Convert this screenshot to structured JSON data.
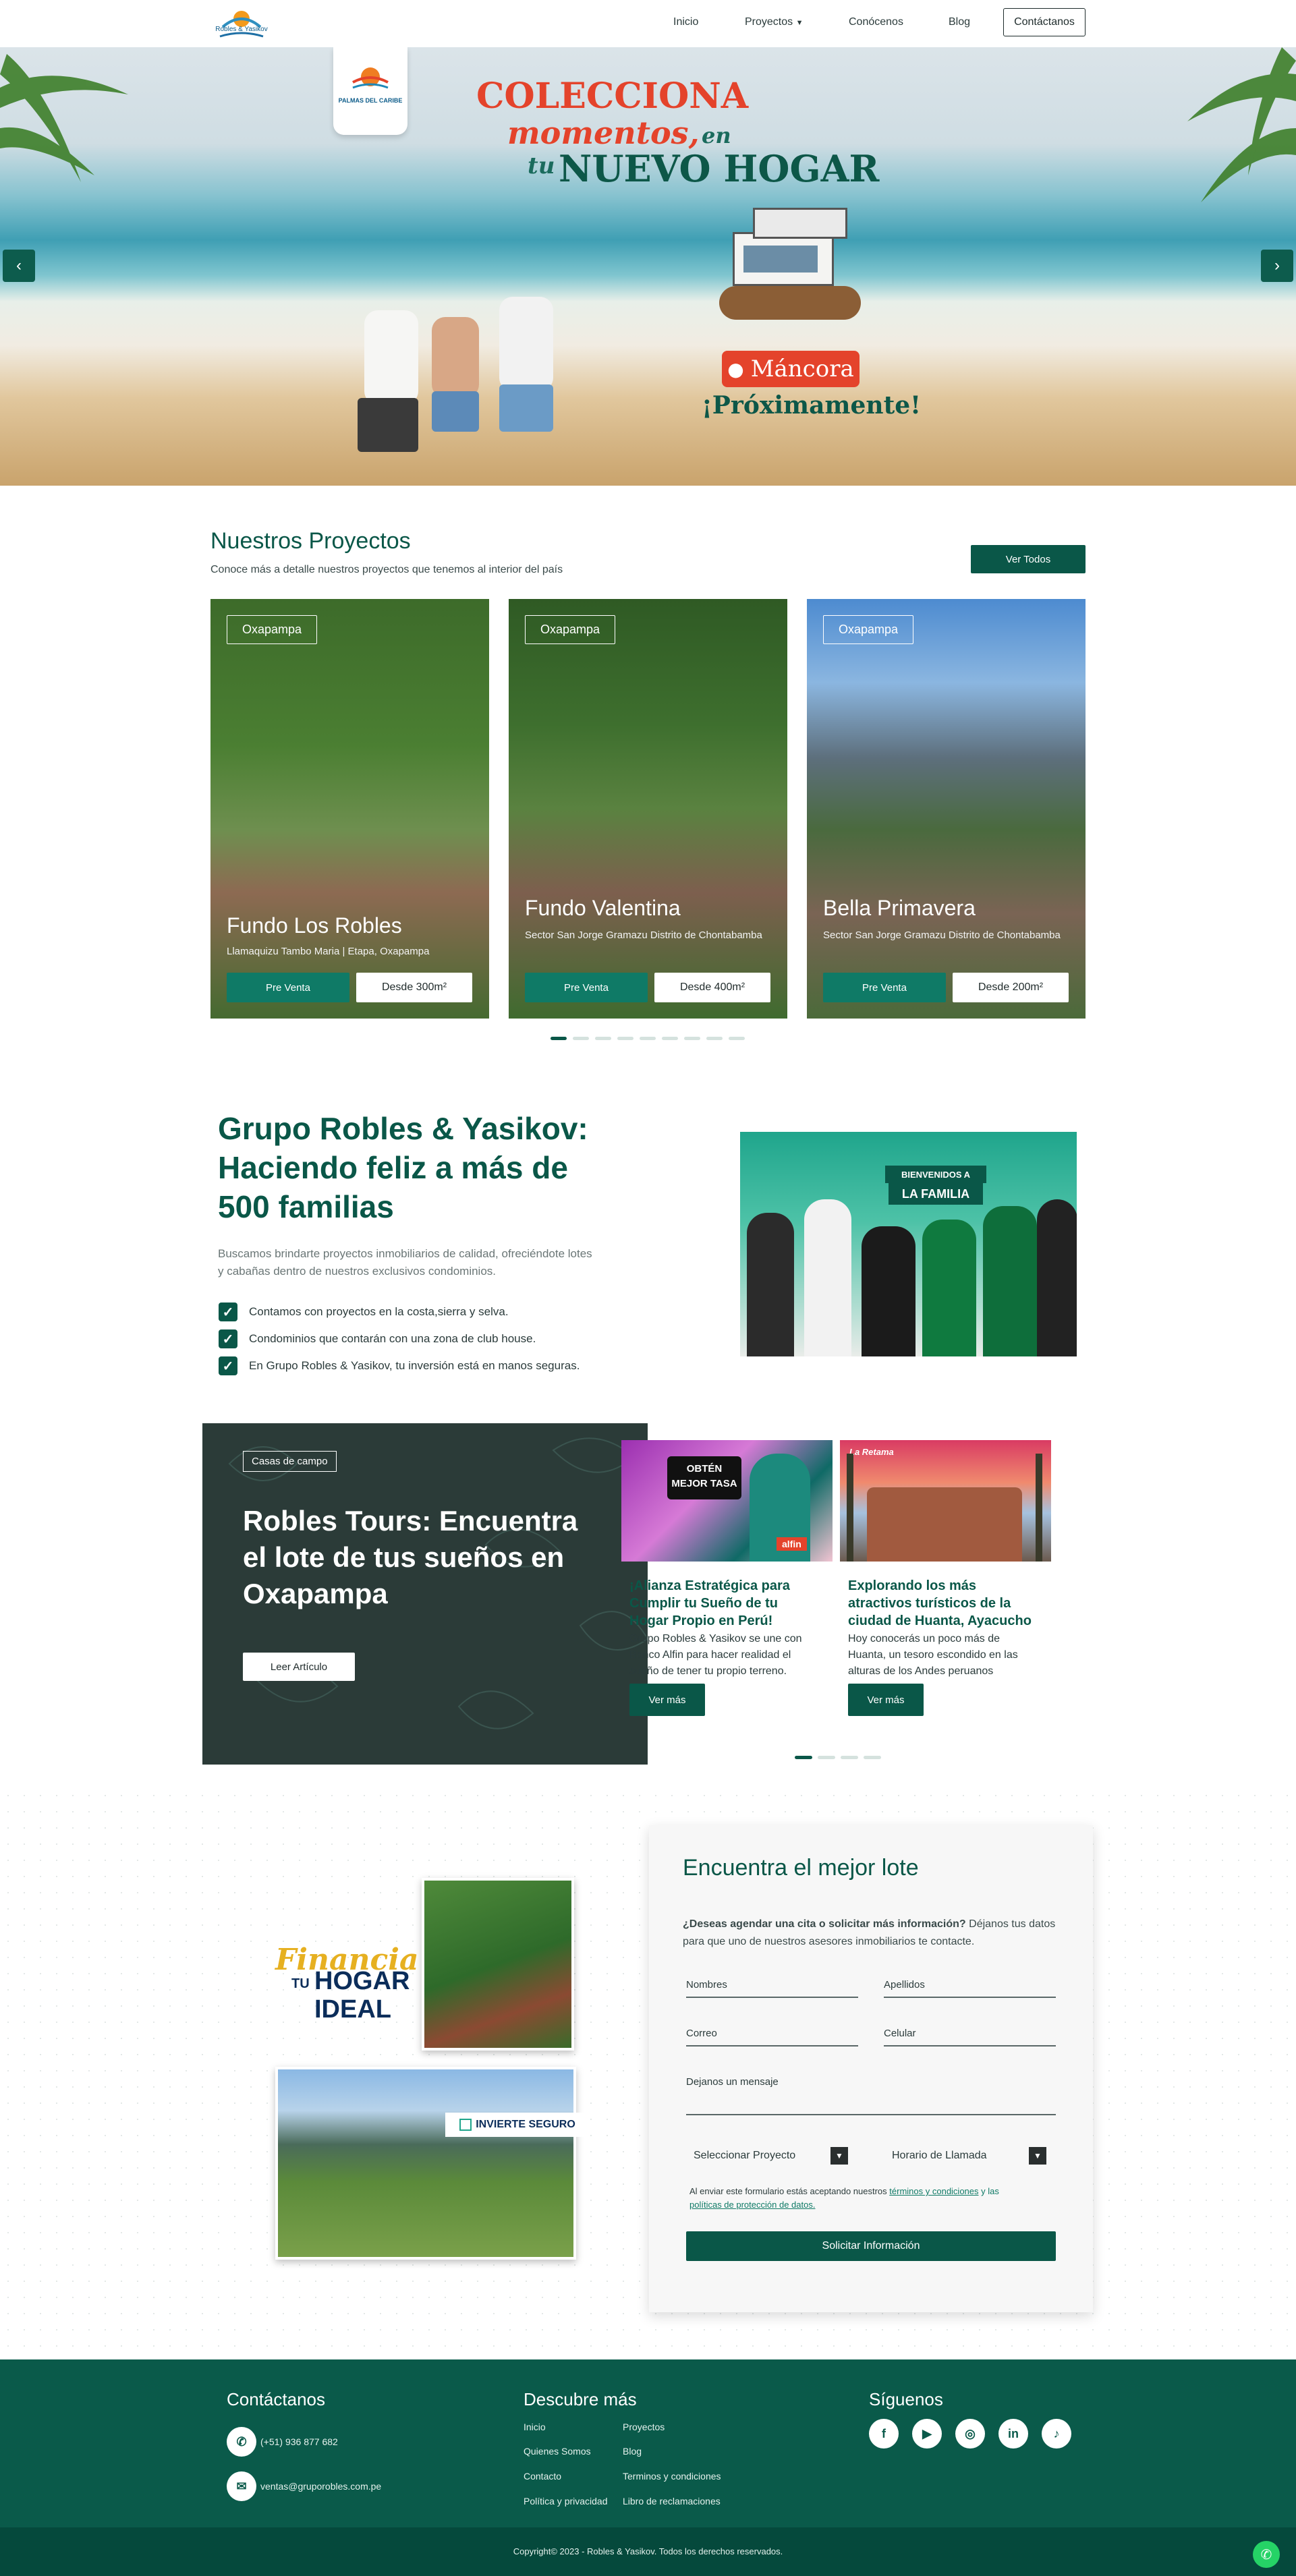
{
  "nav": {
    "logo_text": "Robles & Yasikov",
    "items": [
      "Inicio",
      "Proyectos",
      "Conócenos",
      "Blog"
    ],
    "contact_label": "Contáctanos"
  },
  "hero": {
    "badge_text": "PALMAS DEL CARIBE",
    "line1": "COLECCIONA",
    "line2": "momentos,",
    "line2b": "en",
    "line3a": "tu",
    "line3b": "NUEVO HOGAR",
    "location": "Máncora",
    "soon": "¡Próximamente!"
  },
  "projects": {
    "title": "Nuestros Proyectos",
    "subtitle": "Conoce más a detalle nuestros proyectos que tenemos al interior del país",
    "see_all": "Ver Todos",
    "cards": [
      {
        "tag": "Oxapampa",
        "name": "Fundo Los Robles",
        "location": "Llamaquizu Tambo Maria | Etapa, Oxapampa",
        "cta": "Pre Venta",
        "price": "Desde 300m²"
      },
      {
        "tag": "Oxapampa",
        "name": "Fundo Valentina",
        "location": "Sector San Jorge Gramazu Distrito de Chontabamba",
        "cta": "Pre Venta",
        "price": "Desde 400m²"
      },
      {
        "tag": "Oxapampa",
        "name": "Bella Primavera",
        "location": "Sector San Jorge Gramazu Distrito de Chontabamba",
        "cta": "Pre Venta",
        "price": "Desde 200m²"
      }
    ]
  },
  "about": {
    "title_line1": "Grupo Robles & Yasikov:",
    "title_line2": "Haciendo feliz a más de",
    "title_line3": "500 familias",
    "text_line1": "Buscamos brindarte proyectos inmobiliarios de calidad, ofreciéndote lotes",
    "text_line2": "y cabañas dentro de nuestros exclusivos condominios.",
    "checks": [
      "Contamos con proyectos en la costa,sierra y selva.",
      "Condominios que contarán con una zona de club house.",
      "En Grupo Robles & Yasikov, tu inversión está en manos seguras."
    ],
    "photo_banner_1": "BIENVENIDOS A",
    "photo_banner_2": "LA FAMILIA"
  },
  "blog": {
    "feature_tag": "Casas de campo",
    "feature_line1": "Robles Tours: Encuentra",
    "feature_line2": "el lote de tus sueños en",
    "feature_line3": "Oxapampa",
    "feature_cta": "Leer Artículo",
    "posts": [
      {
        "title_1": "¡Alianza Estratégica para",
        "title_2": "Cumplir tu Sueño de tu",
        "title_3": "Hogar Propio en Perú!",
        "text_1": "Grupo Robles & Yasikov se une con",
        "text_2": "Banco Alfin para hacer realidad el",
        "text_3": "sueño de tener tu propio terreno.",
        "cta": "Ver más",
        "img_text_1": "OBTÉN",
        "img_text_2": "MEJOR TASA",
        "img_brand": "alfin"
      },
      {
        "title_1": "Explorando los más",
        "title_2": "atractivos turísticos de la",
        "title_3": "ciudad de Huanta, Ayacucho",
        "text_1": "Hoy conocerás un poco más de",
        "text_2": "Huanta, un tesoro escondido en las",
        "text_3": "alturas de los Andes peruanos",
        "cta": "Ver más",
        "img_text_1": "La Retama",
        "img_text_2": "",
        "img_brand": ""
      }
    ]
  },
  "promo": {
    "financia": "Financia",
    "tu": "TU",
    "hogar": "HOGAR",
    "ideal": "IDEAL",
    "invierte": "INVIERTE SEGURO"
  },
  "form": {
    "title": "Encuentra el mejor lote",
    "intro_bold": "¿Deseas agendar una cita o solicitar más información?",
    "intro_rest": " Déjanos tus datos",
    "intro_line2": "para que uno de nuestros asesores inmobiliarios te contacte.",
    "nombres": "Nombres",
    "apellidos": "Apellidos",
    "correo": "Correo",
    "celular": "Celular",
    "mensaje": "Dejanos un mensaje",
    "select_project": "Seleccionar Proyecto",
    "select_time": "Horario de Llamada",
    "legal_1": "Al enviar este formulario estás aceptando nuestros ",
    "legal_link1": "términos y condiciones",
    "legal_2": " y las",
    "legal_link2": "políticas de protección de datos.",
    "submit": "Solicitar Información"
  },
  "footer": {
    "contact_title": "Contáctanos",
    "phone": "(+51) 936 877 682",
    "email": "ventas@gruporobles.com.pe",
    "discover_title": "Descubre más",
    "links_col1": [
      "Inicio",
      "Quienes Somos",
      "Contacto",
      "Política y privacidad"
    ],
    "links_col2": [
      "Proyectos",
      "Blog",
      "Terminos y condiciones",
      "Libro de reclamaciones"
    ],
    "follow_title": "Síguenos",
    "social": [
      "f",
      "▶",
      "◎",
      "in",
      "♪"
    ],
    "copyright": "Copyright© 2023 - Robles & Yasikov. Todos los derechos reservados."
  },
  "colors": {
    "brand": "#0a5748",
    "accent": "#0f7a66",
    "footer": "#0a5a4a",
    "hero_red": "#e4432b"
  }
}
